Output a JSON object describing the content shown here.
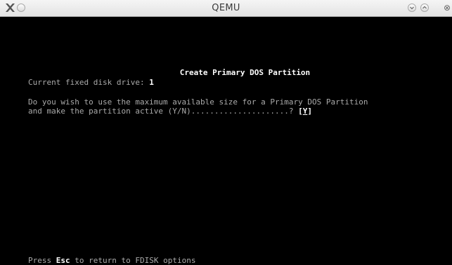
{
  "window": {
    "title": "QEMU"
  },
  "fdisk": {
    "heading": "Create Primary DOS Partition",
    "drive_label": "Current fixed disk drive:",
    "drive_number": "1",
    "question_line1": "Do you wish to use the maximum available size for a Primary DOS Partition",
    "question_line2": "and make the partition active (Y/N).....................?",
    "answer_open": "[",
    "answer_value": "Y",
    "answer_close": "]",
    "footer_prefix": "Press",
    "footer_key": "Esc",
    "footer_suffix": "to return to FDISK options"
  }
}
